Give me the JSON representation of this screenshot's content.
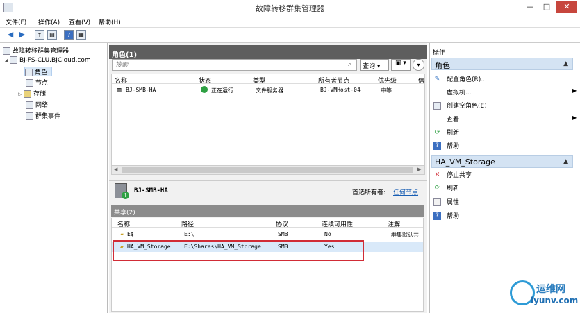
{
  "window": {
    "title": "故障转移群集管理器",
    "min": "—",
    "max": "□",
    "close": "✕"
  },
  "menu": [
    "文件(F)",
    "操作(A)",
    "查看(V)",
    "帮助(H)"
  ],
  "tree": {
    "root": "故障转移群集管理器",
    "cluster": "BJ-FS-CLU.BJCloud.com",
    "items": [
      "角色",
      "节点",
      "存储",
      "网络",
      "群集事件"
    ]
  },
  "roles_pane": {
    "title": "角色(1)",
    "search_placeholder": "搜索",
    "query_label": "查询",
    "columns": [
      "名称",
      "状态",
      "类型",
      "所有者节点",
      "优先级",
      "信"
    ],
    "rows": [
      {
        "name": "BJ-SMB-HA",
        "status": "正在运行",
        "type": "文件服务器",
        "owner": "BJ-VMHost-04",
        "priority": "中等"
      }
    ]
  },
  "detail": {
    "role_name": "BJ-SMB-HA",
    "preferred_owner_label": "首选所有者:",
    "preferred_owner_value": "任何节点"
  },
  "shares": {
    "title": "共享(2)",
    "columns": [
      "名称",
      "路径",
      "协议",
      "连续可用性",
      "注解"
    ],
    "rows": [
      {
        "name": "E$",
        "path": "E:\\",
        "protocol": "SMB",
        "ca": "No",
        "note": "群集默认共"
      },
      {
        "name": "HA_VM_Storage",
        "path": "E:\\Shares\\HA_VM_Storage",
        "protocol": "SMB",
        "ca": "Yes",
        "note": ""
      }
    ]
  },
  "actions": {
    "header": "操作",
    "section1": "角色",
    "section1_items": [
      "配置角色(R)...",
      "虚拟机...",
      "创建空角色(E)",
      "查看",
      "刷新",
      "帮助"
    ],
    "section2": "HA_VM_Storage",
    "section2_items": [
      "停止共享",
      "刷新",
      "属性",
      "帮助"
    ]
  },
  "watermark": {
    "line1": "运维网",
    "line2": "iyunv.com"
  },
  "colors": {
    "header_dark": "#5e5e5e",
    "section_blue": "#d4e3f3",
    "highlight_red": "#d12c36",
    "running_green": "#2ea043"
  }
}
